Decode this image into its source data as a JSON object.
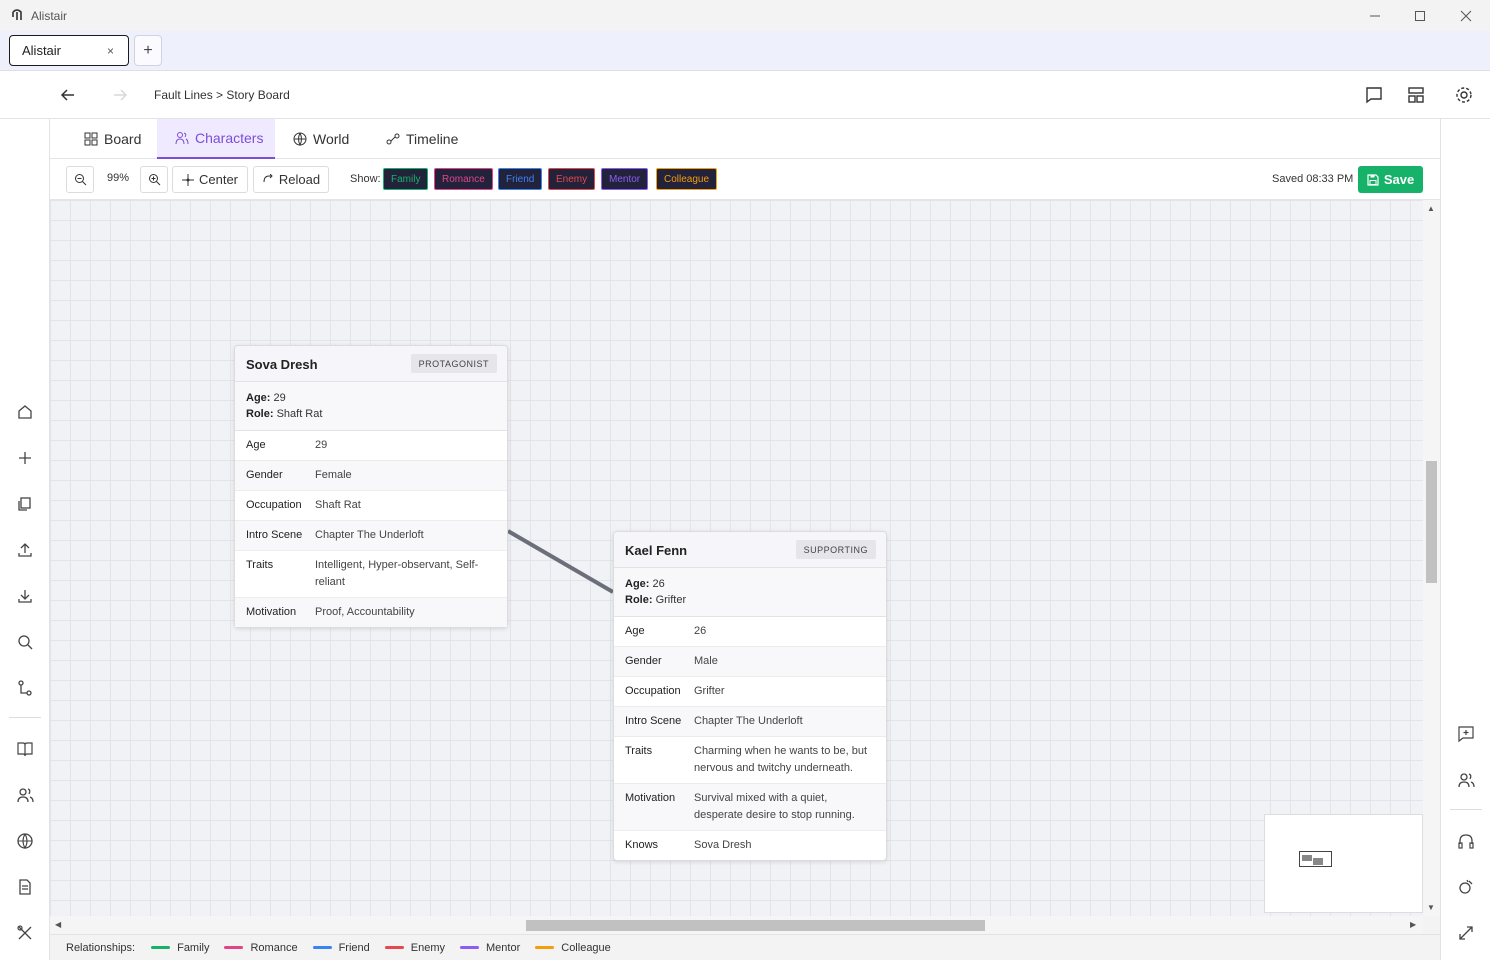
{
  "window": {
    "title": "Alistair"
  },
  "tabs": [
    {
      "label": "Alistair",
      "close": "×"
    }
  ],
  "newtab": "+",
  "breadcrumb": {
    "path": "Fault Lines > Story Board"
  },
  "section_tabs": [
    {
      "label": "Board",
      "icon": "grid-icon"
    },
    {
      "label": "Characters",
      "icon": "users-icon",
      "active": true
    },
    {
      "label": "World",
      "icon": "globe-icon"
    },
    {
      "label": "Timeline",
      "icon": "timeline-icon"
    }
  ],
  "toolbar": {
    "zoom_value": "99%",
    "center_label": "Center",
    "reload_label": "Reload",
    "show_label": "Show:",
    "filters": [
      {
        "label": "Family",
        "color": "#17b26a"
      },
      {
        "label": "Romance",
        "color": "#e0458a"
      },
      {
        "label": "Friend",
        "color": "#3b82f6"
      },
      {
        "label": "Enemy",
        "color": "#e5484d"
      },
      {
        "label": "Mentor",
        "color": "#8b5cf6"
      },
      {
        "label": "Colleague",
        "color": "#f59e0b"
      }
    ],
    "saved_text": "Saved 08:33 PM",
    "save_label": "Save"
  },
  "characters": [
    {
      "name": "Sova Dresh",
      "badge": "PROTAGONIST",
      "summary_age_label": "Age:",
      "summary_age": "29",
      "summary_role_label": "Role:",
      "summary_role": "Shaft Rat",
      "attributes": [
        {
          "key": "Age",
          "value": "29"
        },
        {
          "key": "Gender",
          "value": "Female"
        },
        {
          "key": "Occupation",
          "value": "Shaft Rat"
        },
        {
          "key": "Intro Scene",
          "value": "Chapter The Underloft"
        },
        {
          "key": "Traits",
          "value": "Intelligent, Hyper-observant, Self-reliant"
        },
        {
          "key": "Motivation",
          "value": "Proof, Accountability"
        }
      ]
    },
    {
      "name": "Kael Fenn",
      "badge": "SUPPORTING",
      "summary_age_label": "Age:",
      "summary_age": "26",
      "summary_role_label": "Role:",
      "summary_role": "Grifter",
      "attributes": [
        {
          "key": "Age",
          "value": "26"
        },
        {
          "key": "Gender",
          "value": "Male"
        },
        {
          "key": "Occupation",
          "value": "Grifter"
        },
        {
          "key": "Intro Scene",
          "value": "Chapter The Underloft"
        },
        {
          "key": "Traits",
          "value": "Charming when he wants to be, but nervous and twitchy underneath."
        },
        {
          "key": "Motivation",
          "value": "Survival mixed with a quiet, desperate desire to stop running."
        },
        {
          "key": "Knows",
          "value": "Sova Dresh"
        }
      ]
    }
  ],
  "legend": {
    "label": "Relationships:",
    "items": [
      {
        "label": "Family",
        "color": "#17b26a"
      },
      {
        "label": "Romance",
        "color": "#e0458a"
      },
      {
        "label": "Friend",
        "color": "#3b82f6"
      },
      {
        "label": "Enemy",
        "color": "#e5484d"
      },
      {
        "label": "Mentor",
        "color": "#8b5cf6"
      },
      {
        "label": "Colleague",
        "color": "#f59e0b"
      }
    ]
  }
}
